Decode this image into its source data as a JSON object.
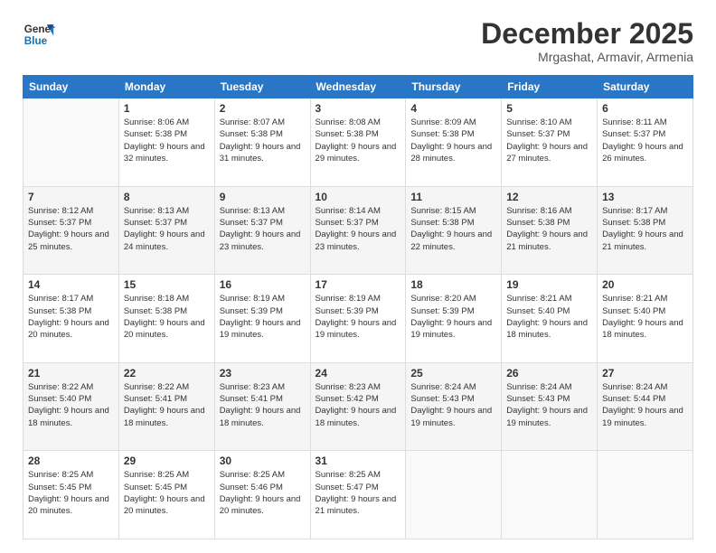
{
  "logo": {
    "line1": "General",
    "line2": "Blue"
  },
  "header": {
    "title": "December 2025",
    "subtitle": "Mrgashat, Armavir, Armenia"
  },
  "weekdays": [
    "Sunday",
    "Monday",
    "Tuesday",
    "Wednesday",
    "Thursday",
    "Friday",
    "Saturday"
  ],
  "weeks": [
    [
      {
        "day": "",
        "sunrise": "",
        "sunset": "",
        "daylight": ""
      },
      {
        "day": "1",
        "sunrise": "Sunrise: 8:06 AM",
        "sunset": "Sunset: 5:38 PM",
        "daylight": "Daylight: 9 hours and 32 minutes."
      },
      {
        "day": "2",
        "sunrise": "Sunrise: 8:07 AM",
        "sunset": "Sunset: 5:38 PM",
        "daylight": "Daylight: 9 hours and 31 minutes."
      },
      {
        "day": "3",
        "sunrise": "Sunrise: 8:08 AM",
        "sunset": "Sunset: 5:38 PM",
        "daylight": "Daylight: 9 hours and 29 minutes."
      },
      {
        "day": "4",
        "sunrise": "Sunrise: 8:09 AM",
        "sunset": "Sunset: 5:38 PM",
        "daylight": "Daylight: 9 hours and 28 minutes."
      },
      {
        "day": "5",
        "sunrise": "Sunrise: 8:10 AM",
        "sunset": "Sunset: 5:37 PM",
        "daylight": "Daylight: 9 hours and 27 minutes."
      },
      {
        "day": "6",
        "sunrise": "Sunrise: 8:11 AM",
        "sunset": "Sunset: 5:37 PM",
        "daylight": "Daylight: 9 hours and 26 minutes."
      }
    ],
    [
      {
        "day": "7",
        "sunrise": "Sunrise: 8:12 AM",
        "sunset": "Sunset: 5:37 PM",
        "daylight": "Daylight: 9 hours and 25 minutes."
      },
      {
        "day": "8",
        "sunrise": "Sunrise: 8:13 AM",
        "sunset": "Sunset: 5:37 PM",
        "daylight": "Daylight: 9 hours and 24 minutes."
      },
      {
        "day": "9",
        "sunrise": "Sunrise: 8:13 AM",
        "sunset": "Sunset: 5:37 PM",
        "daylight": "Daylight: 9 hours and 23 minutes."
      },
      {
        "day": "10",
        "sunrise": "Sunrise: 8:14 AM",
        "sunset": "Sunset: 5:37 PM",
        "daylight": "Daylight: 9 hours and 23 minutes."
      },
      {
        "day": "11",
        "sunrise": "Sunrise: 8:15 AM",
        "sunset": "Sunset: 5:38 PM",
        "daylight": "Daylight: 9 hours and 22 minutes."
      },
      {
        "day": "12",
        "sunrise": "Sunrise: 8:16 AM",
        "sunset": "Sunset: 5:38 PM",
        "daylight": "Daylight: 9 hours and 21 minutes."
      },
      {
        "day": "13",
        "sunrise": "Sunrise: 8:17 AM",
        "sunset": "Sunset: 5:38 PM",
        "daylight": "Daylight: 9 hours and 21 minutes."
      }
    ],
    [
      {
        "day": "14",
        "sunrise": "Sunrise: 8:17 AM",
        "sunset": "Sunset: 5:38 PM",
        "daylight": "Daylight: 9 hours and 20 minutes."
      },
      {
        "day": "15",
        "sunrise": "Sunrise: 8:18 AM",
        "sunset": "Sunset: 5:38 PM",
        "daylight": "Daylight: 9 hours and 20 minutes."
      },
      {
        "day": "16",
        "sunrise": "Sunrise: 8:19 AM",
        "sunset": "Sunset: 5:39 PM",
        "daylight": "Daylight: 9 hours and 19 minutes."
      },
      {
        "day": "17",
        "sunrise": "Sunrise: 8:19 AM",
        "sunset": "Sunset: 5:39 PM",
        "daylight": "Daylight: 9 hours and 19 minutes."
      },
      {
        "day": "18",
        "sunrise": "Sunrise: 8:20 AM",
        "sunset": "Sunset: 5:39 PM",
        "daylight": "Daylight: 9 hours and 19 minutes."
      },
      {
        "day": "19",
        "sunrise": "Sunrise: 8:21 AM",
        "sunset": "Sunset: 5:40 PM",
        "daylight": "Daylight: 9 hours and 18 minutes."
      },
      {
        "day": "20",
        "sunrise": "Sunrise: 8:21 AM",
        "sunset": "Sunset: 5:40 PM",
        "daylight": "Daylight: 9 hours and 18 minutes."
      }
    ],
    [
      {
        "day": "21",
        "sunrise": "Sunrise: 8:22 AM",
        "sunset": "Sunset: 5:40 PM",
        "daylight": "Daylight: 9 hours and 18 minutes."
      },
      {
        "day": "22",
        "sunrise": "Sunrise: 8:22 AM",
        "sunset": "Sunset: 5:41 PM",
        "daylight": "Daylight: 9 hours and 18 minutes."
      },
      {
        "day": "23",
        "sunrise": "Sunrise: 8:23 AM",
        "sunset": "Sunset: 5:41 PM",
        "daylight": "Daylight: 9 hours and 18 minutes."
      },
      {
        "day": "24",
        "sunrise": "Sunrise: 8:23 AM",
        "sunset": "Sunset: 5:42 PM",
        "daylight": "Daylight: 9 hours and 18 minutes."
      },
      {
        "day": "25",
        "sunrise": "Sunrise: 8:24 AM",
        "sunset": "Sunset: 5:43 PM",
        "daylight": "Daylight: 9 hours and 19 minutes."
      },
      {
        "day": "26",
        "sunrise": "Sunrise: 8:24 AM",
        "sunset": "Sunset: 5:43 PM",
        "daylight": "Daylight: 9 hours and 19 minutes."
      },
      {
        "day": "27",
        "sunrise": "Sunrise: 8:24 AM",
        "sunset": "Sunset: 5:44 PM",
        "daylight": "Daylight: 9 hours and 19 minutes."
      }
    ],
    [
      {
        "day": "28",
        "sunrise": "Sunrise: 8:25 AM",
        "sunset": "Sunset: 5:45 PM",
        "daylight": "Daylight: 9 hours and 20 minutes."
      },
      {
        "day": "29",
        "sunrise": "Sunrise: 8:25 AM",
        "sunset": "Sunset: 5:45 PM",
        "daylight": "Daylight: 9 hours and 20 minutes."
      },
      {
        "day": "30",
        "sunrise": "Sunrise: 8:25 AM",
        "sunset": "Sunset: 5:46 PM",
        "daylight": "Daylight: 9 hours and 20 minutes."
      },
      {
        "day": "31",
        "sunrise": "Sunrise: 8:25 AM",
        "sunset": "Sunset: 5:47 PM",
        "daylight": "Daylight: 9 hours and 21 minutes."
      },
      {
        "day": "",
        "sunrise": "",
        "sunset": "",
        "daylight": ""
      },
      {
        "day": "",
        "sunrise": "",
        "sunset": "",
        "daylight": ""
      },
      {
        "day": "",
        "sunrise": "",
        "sunset": "",
        "daylight": ""
      }
    ]
  ]
}
